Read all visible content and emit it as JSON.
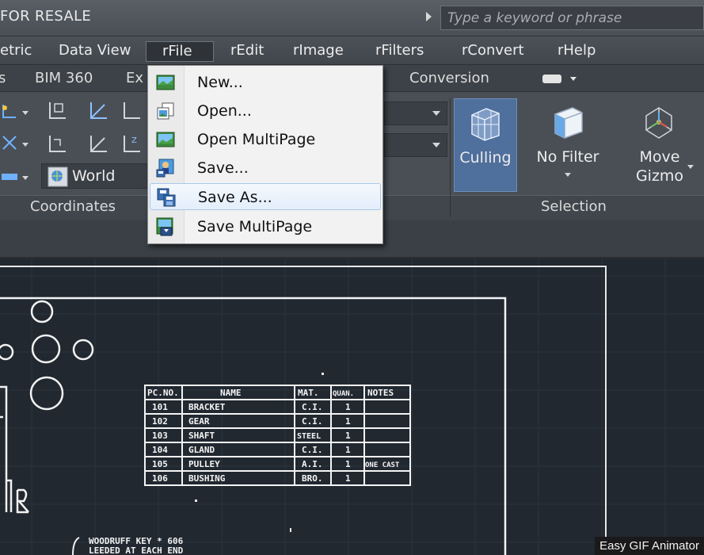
{
  "titlebar": {
    "title": "FOR RESALE",
    "search_placeholder": "Type a keyword or phrase"
  },
  "menubar": {
    "items": [
      {
        "label": "etric"
      },
      {
        "label": "Data View"
      },
      {
        "label": "rFile"
      },
      {
        "label": "rEdit"
      },
      {
        "label": "rImage"
      },
      {
        "label": "rFilters"
      },
      {
        "label": "rConvert"
      },
      {
        "label": "rHelp"
      }
    ]
  },
  "tabbar": {
    "items": [
      {
        "label": "s"
      },
      {
        "label": "BIM 360"
      },
      {
        "label": "Ex"
      },
      {
        "label": "Conversion"
      }
    ]
  },
  "ribbon": {
    "world_label": "World",
    "panels": {
      "coordinates": "Coordinates",
      "selection": "Selection"
    },
    "big_tools": {
      "culling": "Culling",
      "no_filter": "No Filter",
      "move_gizmo_1": "Move",
      "move_gizmo_2": "Gizmo"
    }
  },
  "file_menu": {
    "items": [
      {
        "label": "New...",
        "icon": "new-image-icon"
      },
      {
        "label": "Open...",
        "icon": "open-image-icon"
      },
      {
        "label": "Open MultiPage",
        "icon": "open-multipage-icon"
      },
      {
        "label": "Save...",
        "icon": "save-image-icon"
      },
      {
        "label": "Save As...",
        "icon": "save-as-icon"
      },
      {
        "label": "Save MultiPage",
        "icon": "save-multipage-icon"
      }
    ]
  },
  "drawing": {
    "table_headers": [
      "PC.NO.",
      "NAME",
      "MAT.",
      "QUAN.",
      "NOTES"
    ],
    "rows": [
      [
        "101",
        "BRACKET",
        "C.I.",
        "1",
        ""
      ],
      [
        "102",
        "GEAR",
        "C.I.",
        "1",
        ""
      ],
      [
        "103",
        "SHAFT",
        "STEEL",
        "1",
        ""
      ],
      [
        "104",
        "GLAND",
        "C.I.",
        "1",
        ""
      ],
      [
        "105",
        "PULLEY",
        "A.I.",
        "1",
        "ONE CAST"
      ],
      [
        "106",
        "BUSHING",
        "BRO.",
        "1",
        ""
      ]
    ],
    "note_line1": "WOODRUFF KEY * 606",
    "note_line2": "LEEDED AT EACH END"
  },
  "watermark": "Easy GIF Animator"
}
